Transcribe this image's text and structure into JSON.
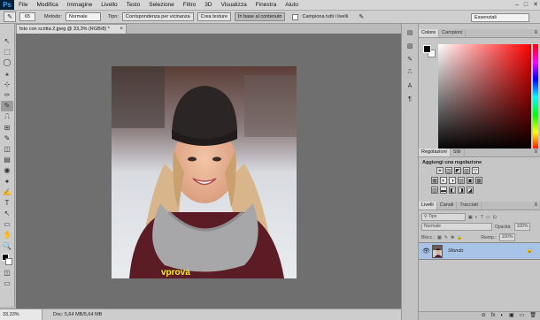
{
  "app": {
    "logo": "Ps"
  },
  "menu": [
    "File",
    "Modifica",
    "Immagine",
    "Livello",
    "Testo",
    "Selezione",
    "Filtro",
    "3D",
    "Visualizza",
    "Finestra",
    "Aiuto"
  ],
  "window_controls": [
    "–",
    "□",
    "✕"
  ],
  "options": {
    "brush_size": "65",
    "metodo_label": "Metodo:",
    "metodo_value": "Normale",
    "tipo_label": "Tipo:",
    "tipo_buttons": [
      "Corrispondenza per vicinanza",
      "Crea texture",
      "In base al contenuto"
    ],
    "sample_all_label": "Campiona tutti i livelli",
    "workspace": "Essenziali"
  },
  "document": {
    "tab_title": "foto con scritta 2.jpeg @ 33,3% (RGB/8) *",
    "close": "×",
    "watermark_text": "vprova"
  },
  "status": {
    "zoom": "33,33%",
    "doc_size": "Doc: 5,64 MB/5,64 MB"
  },
  "color_panel": {
    "tabs": [
      "Colore",
      "Campioni"
    ],
    "fg_color": "#000000",
    "bg_color": "#ffffff"
  },
  "adjust_panel": {
    "tabs": [
      "Regolazioni",
      "Stili"
    ],
    "title": "Aggiungi una regolazione",
    "row1": [
      "☀",
      "▥",
      "◩",
      "▧",
      "▽"
    ],
    "row2": [
      "▦",
      "◐",
      "◑",
      "▤",
      "▣",
      "▩"
    ],
    "row3": [
      "▨",
      "▬",
      "◧",
      "◨",
      "◪"
    ]
  },
  "layers_panel": {
    "tabs": [
      "Livelli",
      "Canali",
      "Tracciati"
    ],
    "filter_label": "Tipo",
    "blend_mode": "Normale",
    "opacity_label": "Opacità:",
    "opacity_value": "100%",
    "lock_label": "Blocc.:",
    "fill_label": "Riemp.:",
    "fill_value": "100%",
    "layer_name": "Sfondo",
    "footer_icons": [
      "⊝",
      "fx",
      "◐",
      "▣",
      "▭",
      "🗑"
    ]
  },
  "tools": [
    "↖",
    "⬚",
    "◯",
    "⚹",
    "⊹",
    "✑",
    "✎",
    "⎍",
    "⊞",
    "✎",
    "◫",
    "▤",
    "◉",
    "✦",
    "✍",
    "T",
    "↖",
    "▭",
    "✋",
    "🔍"
  ]
}
